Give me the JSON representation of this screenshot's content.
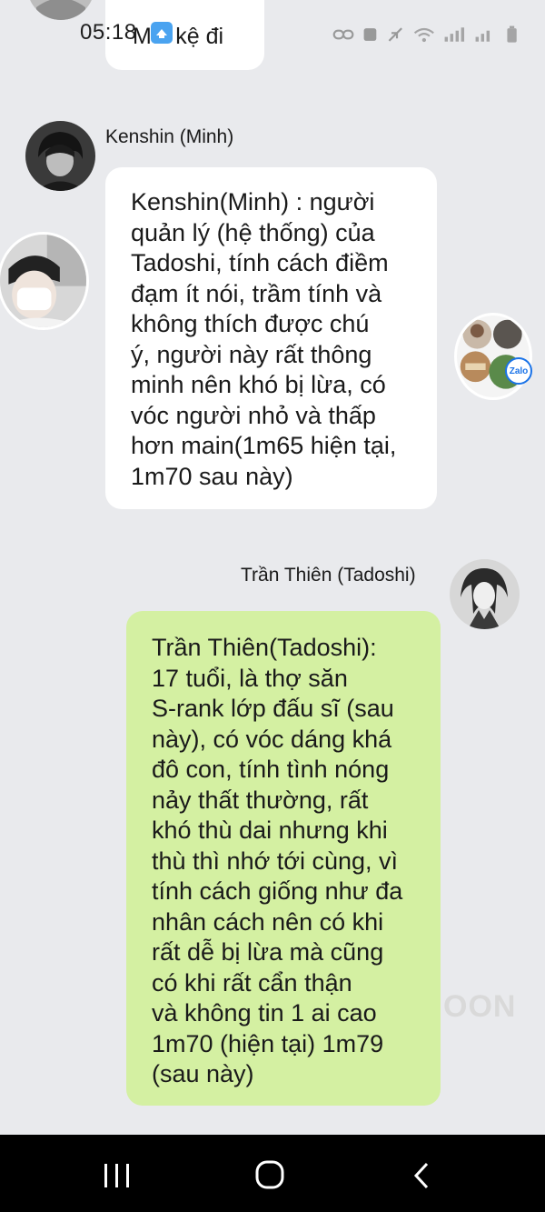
{
  "status_bar": {
    "time": "05:18"
  },
  "messages": [
    {
      "text": "Mai kệ đi",
      "sender": ""
    },
    {
      "sender": "Kenshin (Minh)",
      "text": "Kenshin(Minh) : người\nquản lý (hệ thống) của\nTadoshi, tính cách điềm\nđạm ít nói, trầm tính và\nkhông thích được chú\ný, người này rất thông\nminh nên khó bị lừa, có\nvóc người nhỏ và thấp\nhơn main(1m65 hiện tại,\n1m70 sau này)"
    },
    {
      "sender": "Trần Thiên (Tadoshi)",
      "text": "Trần Thiên(Tadoshi):\n17 tuổi, là thợ săn\nS-rank lớp đấu sĩ (sau\nnày), có vóc dáng khá\nđô con, tính tình nóng\nnảy thất thường, rất\nkhó thù dai nhưng khi\nthù thì nhớ tới cùng, vì\ntính cách giống như đa\nnhân cách nên có khi\nrất dễ bị lừa mà cũng\ncó khi rất cẩn thận\nvà không tin 1 ai cao\n1m70 (hiện tại) 1m79\n(sau này)"
    }
  ],
  "floating": {
    "zalo_badge": "Zalo"
  },
  "watermark": "OON",
  "icons": {
    "nav_recents": "recents-icon",
    "nav_home": "home-icon",
    "nav_back": "back-icon"
  },
  "colors": {
    "background": "#e9eaed",
    "incoming_bubble": "#ffffff",
    "outgoing_bubble": "#d4f0a2",
    "navbar": "#000000"
  }
}
